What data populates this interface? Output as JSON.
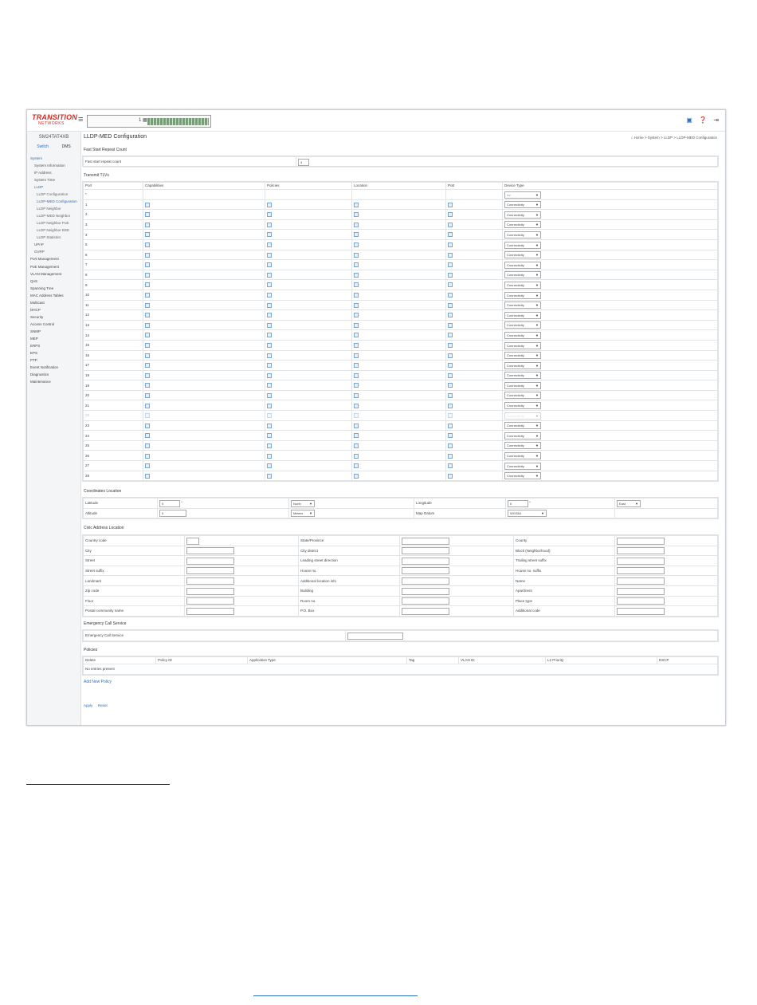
{
  "header": {
    "logo_line1": "TRANSITION",
    "logo_line2": "NETWORKS",
    "hamburger": "≡",
    "icons": [
      "save-icon",
      "help-icon",
      "logout-icon"
    ]
  },
  "sidebar": {
    "model": "SM24TAT4XB",
    "tabs": [
      "Switch",
      "DMS"
    ],
    "items": [
      {
        "label": "System",
        "level": 0,
        "active": true
      },
      {
        "label": "System Information",
        "level": 1
      },
      {
        "label": "IP Address",
        "level": 1
      },
      {
        "label": "System Time",
        "level": 1
      },
      {
        "label": "LLDP",
        "level": 1,
        "active": true
      },
      {
        "label": "LLDP Configuration",
        "level": 2
      },
      {
        "label": "LLDP-MED Configuration",
        "level": 2,
        "active": true
      },
      {
        "label": "LLDP Neighbor",
        "level": 2
      },
      {
        "label": "LLDP-MED Neighbor",
        "level": 2
      },
      {
        "label": "LLDP Neighbor PoE",
        "level": 2
      },
      {
        "label": "LLDP Neighbor EEE",
        "level": 2
      },
      {
        "label": "LLDP Statistics",
        "level": 2
      },
      {
        "label": "UPnP",
        "level": 1
      },
      {
        "label": "GVRP",
        "level": 1
      },
      {
        "label": "Port Management",
        "level": 0
      },
      {
        "label": "PoE Management",
        "level": 0
      },
      {
        "label": "VLAN Management",
        "level": 0
      },
      {
        "label": "QoS",
        "level": 0
      },
      {
        "label": "Spanning Tree",
        "level": 0
      },
      {
        "label": "MAC Address Tables",
        "level": 0
      },
      {
        "label": "Multicast",
        "level": 0
      },
      {
        "label": "DHCP",
        "level": 0
      },
      {
        "label": "Security",
        "level": 0
      },
      {
        "label": "Access Control",
        "level": 0
      },
      {
        "label": "SNMP",
        "level": 0
      },
      {
        "label": "MEP",
        "level": 0
      },
      {
        "label": "ERPS",
        "level": 0
      },
      {
        "label": "EPS",
        "level": 0
      },
      {
        "label": "PTP",
        "level": 0
      },
      {
        "label": "Event Notification",
        "level": 0
      },
      {
        "label": "Diagnostics",
        "level": 0
      },
      {
        "label": "Maintenance",
        "level": 0
      }
    ]
  },
  "page": {
    "title": "LLDP-MED Configuration",
    "breadcrumb": "⌂ Home > System > LLDP > LLDP-MED Configuration"
  },
  "fast_start": {
    "section_label": "Fast Start Repeat Count",
    "field_label": "Fast start repeat count",
    "value": "4"
  },
  "transmit_tlvs": {
    "section_label": "Transmit TLVs",
    "columns": [
      "Port",
      "Capabilities",
      "Policies",
      "Location",
      "PoE",
      "Device Type"
    ],
    "all_row": {
      "port": "*",
      "device_type": "<>"
    },
    "device_type": "Connectivity",
    "ports": [
      "1",
      "2",
      "3",
      "4",
      "5",
      "6",
      "7",
      "8",
      "9",
      "10",
      "11",
      "12",
      "13",
      "14",
      "15",
      "16",
      "17",
      "18",
      "19",
      "20",
      "21",
      "22",
      "23",
      "24",
      "25",
      "26",
      "27",
      "28"
    ]
  },
  "coordinates": {
    "section_label": "Coordinates Location",
    "latitude_label": "Latitude",
    "latitude_value": "0",
    "latitude_unit": "°",
    "latitude_dir": "North",
    "longitude_label": "Longitude",
    "longitude_value": "0",
    "longitude_unit": "°",
    "longitude_dir": "East",
    "altitude_label": "Altitude",
    "altitude_value": "0",
    "altitude_unit": "Meters",
    "datum_label": "Map Datum",
    "datum_value": "WGS84"
  },
  "civic": {
    "section_label": "Civic Address Location",
    "rows": [
      [
        "Country code",
        "State/Province",
        "County"
      ],
      [
        "City",
        "City district",
        "Block (Neighborhood)"
      ],
      [
        "Street",
        "Leading street direction",
        "Trailing street suffix"
      ],
      [
        "Street suffix",
        "House no.",
        "House no. suffix"
      ],
      [
        "Landmark",
        "Additional location info",
        "Name"
      ],
      [
        "Zip code",
        "Building",
        "Apartment"
      ],
      [
        "Floor",
        "Room no.",
        "Place type"
      ],
      [
        "Postal community name",
        "P.O. Box",
        "Additional code"
      ]
    ]
  },
  "emergency": {
    "section_label": "Emergency Call Service",
    "field_label": "Emergency Call Service"
  },
  "policies": {
    "section_label": "Policies",
    "columns": [
      "Delete",
      "Policy ID",
      "Application Type",
      "Tag",
      "VLAN ID",
      "L2 Priority",
      "DSCP"
    ],
    "empty_text": "No entries present",
    "add_label": "Add New Policy"
  },
  "buttons": {
    "apply": "Apply",
    "reset": "Reset"
  }
}
